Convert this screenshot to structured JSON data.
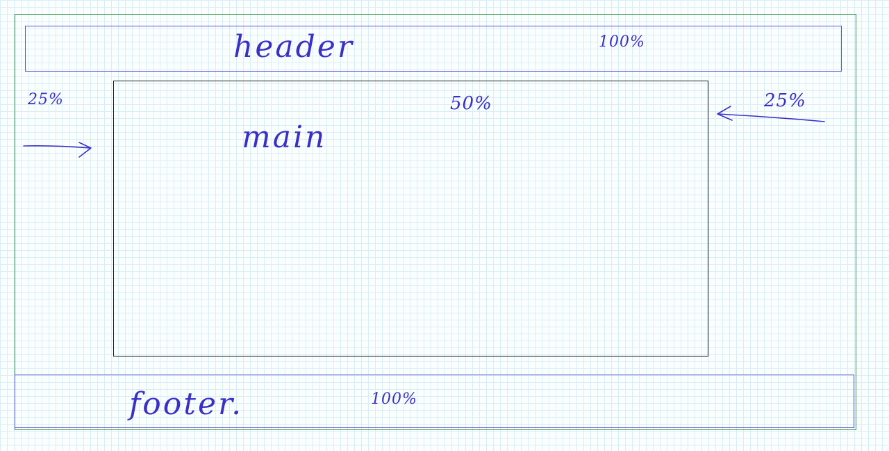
{
  "header": {
    "label": "header",
    "percent": "100%"
  },
  "main": {
    "label": "main",
    "percent": "50%"
  },
  "left_side": {
    "percent": "25%"
  },
  "right_side": {
    "percent": "25%"
  },
  "footer": {
    "label": "footer.",
    "percent": "100%"
  },
  "colors": {
    "ink": "#3a2fc9",
    "box_outline": "#5a4fd6",
    "frame_outline": "#2e8b3a",
    "main_outline": "#1a1a1a",
    "grid_line": "#d8eef4"
  }
}
